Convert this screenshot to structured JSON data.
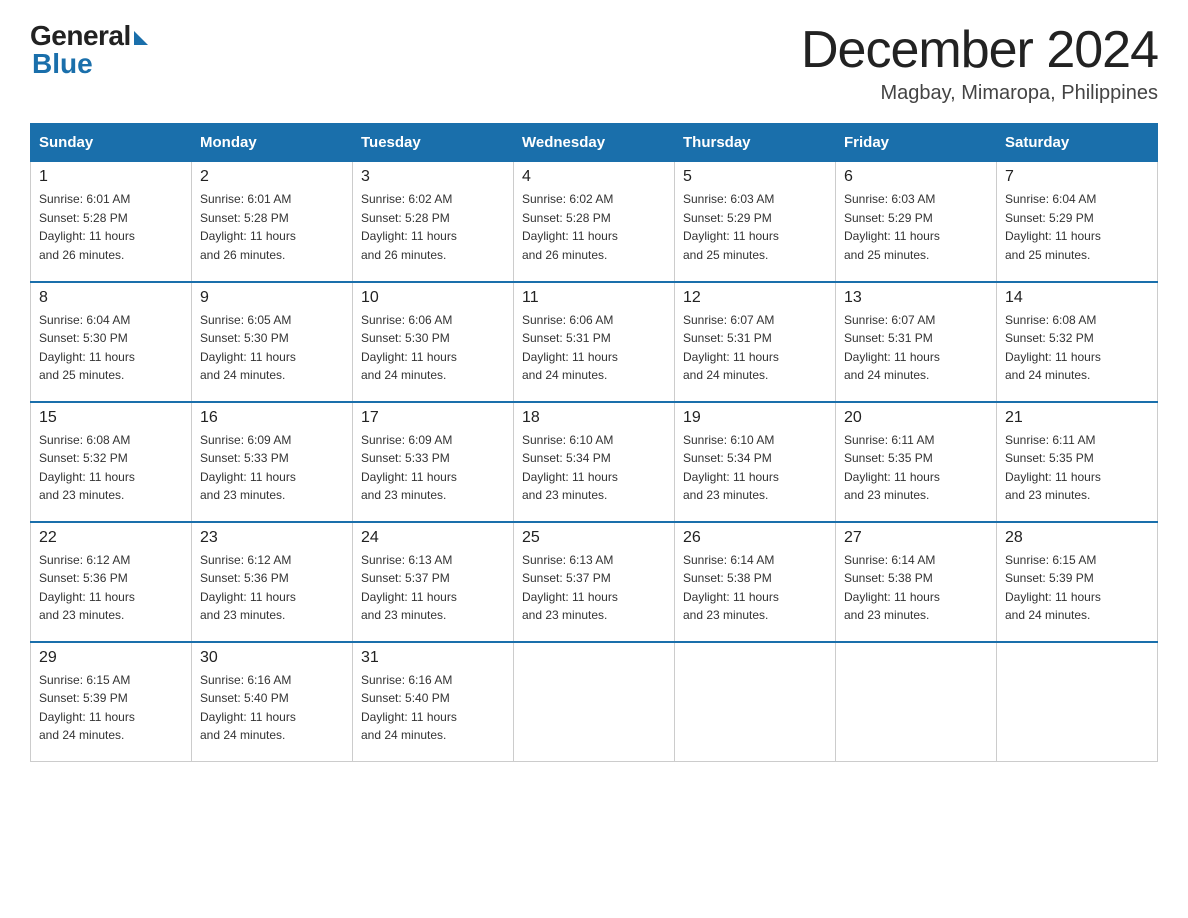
{
  "header": {
    "logo_general": "General",
    "logo_blue": "Blue",
    "title": "December 2024",
    "location": "Magbay, Mimaropa, Philippines"
  },
  "weekdays": [
    "Sunday",
    "Monday",
    "Tuesday",
    "Wednesday",
    "Thursday",
    "Friday",
    "Saturday"
  ],
  "weeks": [
    [
      {
        "day": "1",
        "sunrise": "6:01 AM",
        "sunset": "5:28 PM",
        "daylight": "11 hours and 26 minutes."
      },
      {
        "day": "2",
        "sunrise": "6:01 AM",
        "sunset": "5:28 PM",
        "daylight": "11 hours and 26 minutes."
      },
      {
        "day": "3",
        "sunrise": "6:02 AM",
        "sunset": "5:28 PM",
        "daylight": "11 hours and 26 minutes."
      },
      {
        "day": "4",
        "sunrise": "6:02 AM",
        "sunset": "5:28 PM",
        "daylight": "11 hours and 26 minutes."
      },
      {
        "day": "5",
        "sunrise": "6:03 AM",
        "sunset": "5:29 PM",
        "daylight": "11 hours and 25 minutes."
      },
      {
        "day": "6",
        "sunrise": "6:03 AM",
        "sunset": "5:29 PM",
        "daylight": "11 hours and 25 minutes."
      },
      {
        "day": "7",
        "sunrise": "6:04 AM",
        "sunset": "5:29 PM",
        "daylight": "11 hours and 25 minutes."
      }
    ],
    [
      {
        "day": "8",
        "sunrise": "6:04 AM",
        "sunset": "5:30 PM",
        "daylight": "11 hours and 25 minutes."
      },
      {
        "day": "9",
        "sunrise": "6:05 AM",
        "sunset": "5:30 PM",
        "daylight": "11 hours and 24 minutes."
      },
      {
        "day": "10",
        "sunrise": "6:06 AM",
        "sunset": "5:30 PM",
        "daylight": "11 hours and 24 minutes."
      },
      {
        "day": "11",
        "sunrise": "6:06 AM",
        "sunset": "5:31 PM",
        "daylight": "11 hours and 24 minutes."
      },
      {
        "day": "12",
        "sunrise": "6:07 AM",
        "sunset": "5:31 PM",
        "daylight": "11 hours and 24 minutes."
      },
      {
        "day": "13",
        "sunrise": "6:07 AM",
        "sunset": "5:31 PM",
        "daylight": "11 hours and 24 minutes."
      },
      {
        "day": "14",
        "sunrise": "6:08 AM",
        "sunset": "5:32 PM",
        "daylight": "11 hours and 24 minutes."
      }
    ],
    [
      {
        "day": "15",
        "sunrise": "6:08 AM",
        "sunset": "5:32 PM",
        "daylight": "11 hours and 23 minutes."
      },
      {
        "day": "16",
        "sunrise": "6:09 AM",
        "sunset": "5:33 PM",
        "daylight": "11 hours and 23 minutes."
      },
      {
        "day": "17",
        "sunrise": "6:09 AM",
        "sunset": "5:33 PM",
        "daylight": "11 hours and 23 minutes."
      },
      {
        "day": "18",
        "sunrise": "6:10 AM",
        "sunset": "5:34 PM",
        "daylight": "11 hours and 23 minutes."
      },
      {
        "day": "19",
        "sunrise": "6:10 AM",
        "sunset": "5:34 PM",
        "daylight": "11 hours and 23 minutes."
      },
      {
        "day": "20",
        "sunrise": "6:11 AM",
        "sunset": "5:35 PM",
        "daylight": "11 hours and 23 minutes."
      },
      {
        "day": "21",
        "sunrise": "6:11 AM",
        "sunset": "5:35 PM",
        "daylight": "11 hours and 23 minutes."
      }
    ],
    [
      {
        "day": "22",
        "sunrise": "6:12 AM",
        "sunset": "5:36 PM",
        "daylight": "11 hours and 23 minutes."
      },
      {
        "day": "23",
        "sunrise": "6:12 AM",
        "sunset": "5:36 PM",
        "daylight": "11 hours and 23 minutes."
      },
      {
        "day": "24",
        "sunrise": "6:13 AM",
        "sunset": "5:37 PM",
        "daylight": "11 hours and 23 minutes."
      },
      {
        "day": "25",
        "sunrise": "6:13 AM",
        "sunset": "5:37 PM",
        "daylight": "11 hours and 23 minutes."
      },
      {
        "day": "26",
        "sunrise": "6:14 AM",
        "sunset": "5:38 PM",
        "daylight": "11 hours and 23 minutes."
      },
      {
        "day": "27",
        "sunrise": "6:14 AM",
        "sunset": "5:38 PM",
        "daylight": "11 hours and 23 minutes."
      },
      {
        "day": "28",
        "sunrise": "6:15 AM",
        "sunset": "5:39 PM",
        "daylight": "11 hours and 24 minutes."
      }
    ],
    [
      {
        "day": "29",
        "sunrise": "6:15 AM",
        "sunset": "5:39 PM",
        "daylight": "11 hours and 24 minutes."
      },
      {
        "day": "30",
        "sunrise": "6:16 AM",
        "sunset": "5:40 PM",
        "daylight": "11 hours and 24 minutes."
      },
      {
        "day": "31",
        "sunrise": "6:16 AM",
        "sunset": "5:40 PM",
        "daylight": "11 hours and 24 minutes."
      },
      null,
      null,
      null,
      null
    ]
  ],
  "labels": {
    "sunrise": "Sunrise:",
    "sunset": "Sunset:",
    "daylight": "Daylight:"
  }
}
